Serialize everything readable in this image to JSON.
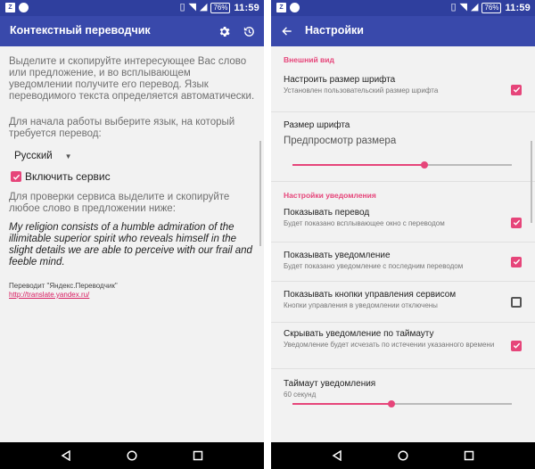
{
  "left_screen": {
    "status_bar": {
      "time": "11:59",
      "battery": "76%"
    },
    "app_bar": {
      "title": "Контекстный переводчик"
    },
    "intro_text": "Выделите и скопируйте интересующее Вас слово или предложение, и во всплывающем уведомлении получите его перевод. Язык переводимого текста определяется автоматически.",
    "language_prompt": "Для начала работы выберите язык, на который требуется перевод:",
    "language_select": {
      "value": "Русский"
    },
    "enable_service": {
      "label": "Включить сервис",
      "checked": true
    },
    "check_prompt": "Для проверки сервиса выделите и скопируйте любое слово в предложении ниже:",
    "sample_text": "My religion consists of a humble admiration of the illimitable superior spirit who reveals himself in the slight details we are able to perceive with our frail and feeble mind.",
    "credit": "Переводит \"Яндекс.Переводчик\"",
    "credit_link": "http://translate.yandex.ru/"
  },
  "right_screen": {
    "status_bar": {
      "time": "11:59",
      "battery": "76%"
    },
    "app_bar": {
      "title": "Настройки"
    },
    "section_appearance": "Внешний вид",
    "custom_font": {
      "title": "Настроить размер шрифта",
      "summary": "Установлен пользовательский размер шрифта",
      "checked": true
    },
    "font_size": {
      "title": "Размер шрифта",
      "preview": "Предпросмотр размера",
      "level": 0.6
    },
    "section_notifications": "Настройки уведомления",
    "show_translation": {
      "title": "Показывать перевод",
      "summary": "Будет показано всплывающее окно с переводом",
      "checked": true
    },
    "show_notification": {
      "title": "Показывать уведомление",
      "summary": "Будет показано уведомление с последним переводом",
      "checked": true
    },
    "show_controls": {
      "title": "Показывать кнопки управления сервисом",
      "summary": "Кнопки управления в уведомлении отключены",
      "checked": false
    },
    "hide_timeout": {
      "title": "Скрывать уведомление по таймауту",
      "summary": "Уведомление будет исчезать по истечении указанного времени",
      "checked": true
    },
    "notification_timeout": {
      "title": "Таймаут уведомления",
      "summary": "60 секунд",
      "level": 0.45
    }
  },
  "colors": {
    "app_bar": "#3949ab",
    "status_bar": "#2f3f9e",
    "accent": "#e6457a",
    "nav_bar": "#000000"
  },
  "icons": {
    "left_app_bar": [
      "gear-icon",
      "history-icon"
    ],
    "right_app_bar": [
      "back-arrow-icon"
    ],
    "nav_bar": [
      "back-icon",
      "home-icon",
      "recents-icon"
    ]
  }
}
